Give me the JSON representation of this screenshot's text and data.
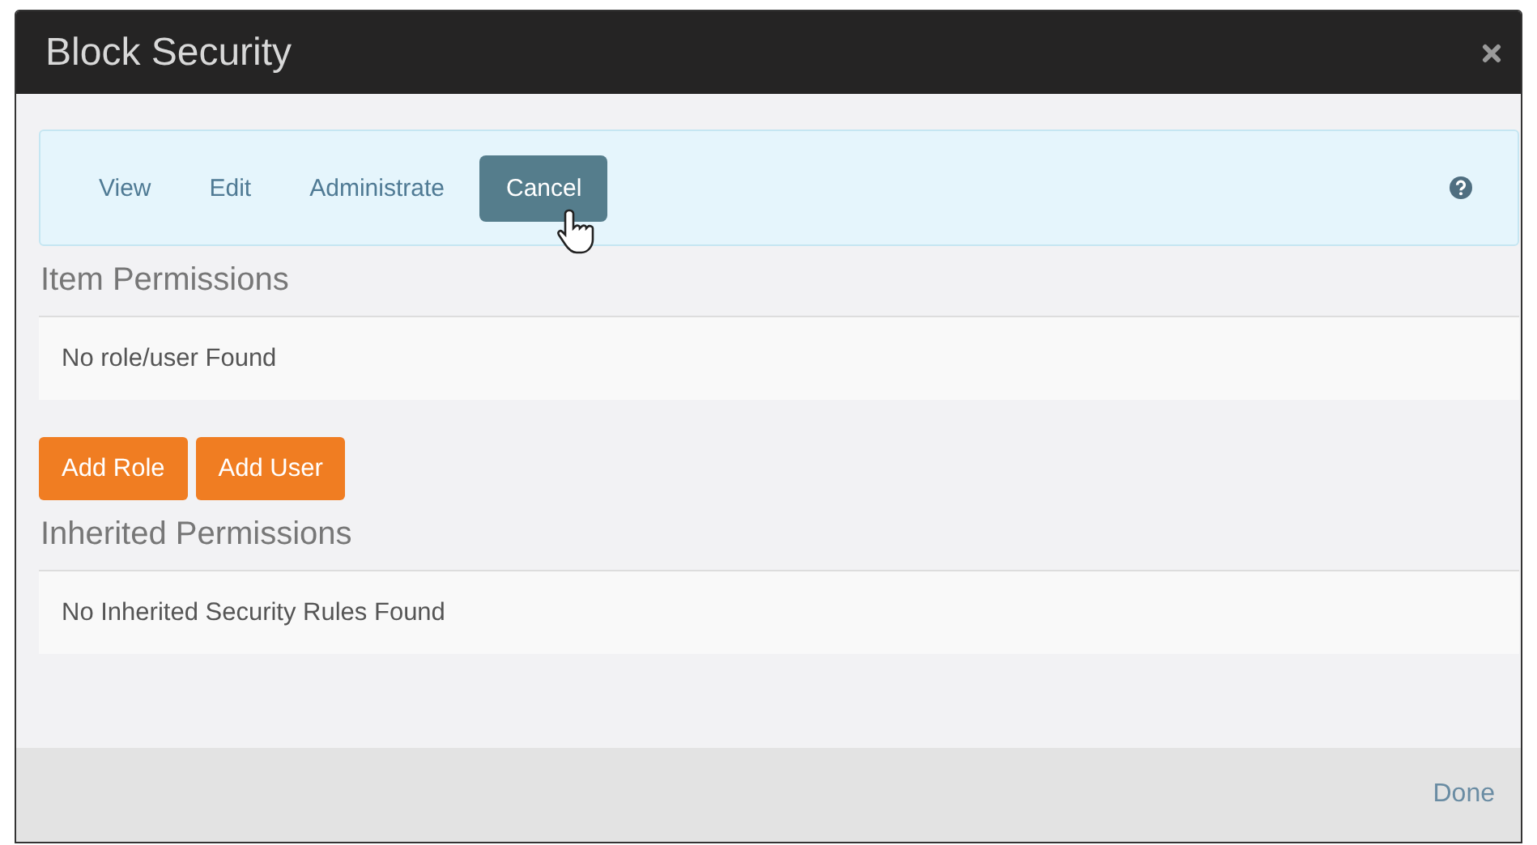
{
  "window": {
    "title": "Block Security"
  },
  "tabs": [
    {
      "label": "View",
      "selected": false
    },
    {
      "label": "Edit",
      "selected": false
    },
    {
      "label": "Administrate",
      "selected": false
    },
    {
      "label": "Cancel",
      "selected": true
    }
  ],
  "sections": [
    {
      "heading": "Item Permissions",
      "message": "No role/user Found",
      "buttons": [
        "Add Role",
        "Add User"
      ]
    },
    {
      "heading": "Inherited Permissions",
      "message": "No Inherited Security Rules Found"
    }
  ],
  "footer": {
    "button": "Done"
  }
}
